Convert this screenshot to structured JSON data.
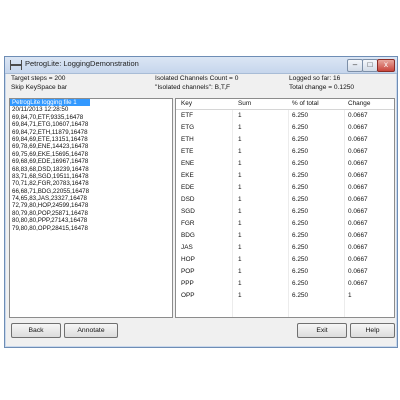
{
  "window": {
    "title": "PetrogLite: LoggingDemonstration",
    "controls": {
      "minimize": "–",
      "maximize": "□",
      "close": "x"
    }
  },
  "info": {
    "target_steps": "Target steps = 200",
    "skip_keyspace": "Skip KeySpace bar",
    "isolated_count": "Isolated Channels Count = 0",
    "isolated_channels": "\"Isolated channels\": B,T,F",
    "logged_so_far": "Logged so far: 16",
    "total_change": "Total change = 0.1250"
  },
  "log": {
    "lines": [
      "PetrogLite logging file 1",
      "20/11/2013 12:28:50",
      "69,84,70,ETF,9335,16478",
      "69,84,71,ETG,10607,16478",
      "69,84,72,ETH,11879,16478",
      "69,84,69,ETE,13151,16478",
      "69,78,69,ENE,14423,16478",
      "69,75,69,EKE,15695,16478",
      "69,68,69,EDE,16967,16478",
      "68,83,68,DSD,18239,16478",
      "83,71,68,SGD,19511,16478",
      "70,71,82,FGR,20783,16478",
      "66,68,71,BDG,22055,16478",
      "74,65,83,JAS,23327,16478",
      "72,79,80,HOP,24599,16478",
      "80,79,80,POP,25871,16478",
      "80,80,80,PPP,27143,16478",
      "79,80,80,OPP,28415,16478"
    ]
  },
  "table": {
    "headers": {
      "key": "Key",
      "sum": "Sum",
      "pct": "% of total",
      "change": "Change"
    },
    "rows": [
      {
        "key": "ETF",
        "sum": "1",
        "pct": "6.250",
        "change": "0.0667"
      },
      {
        "key": "ETG",
        "sum": "1",
        "pct": "6.250",
        "change": "0.0667"
      },
      {
        "key": "ETH",
        "sum": "1",
        "pct": "6.250",
        "change": "0.0667"
      },
      {
        "key": "ETE",
        "sum": "1",
        "pct": "6.250",
        "change": "0.0667"
      },
      {
        "key": "ENE",
        "sum": "1",
        "pct": "6.250",
        "change": "0.0667"
      },
      {
        "key": "EKE",
        "sum": "1",
        "pct": "6.250",
        "change": "0.0667"
      },
      {
        "key": "EDE",
        "sum": "1",
        "pct": "6.250",
        "change": "0.0667"
      },
      {
        "key": "DSD",
        "sum": "1",
        "pct": "6.250",
        "change": "0.0667"
      },
      {
        "key": "SGD",
        "sum": "1",
        "pct": "6.250",
        "change": "0.0667"
      },
      {
        "key": "FGR",
        "sum": "1",
        "pct": "6.250",
        "change": "0.0667"
      },
      {
        "key": "BDG",
        "sum": "1",
        "pct": "6.250",
        "change": "0.0667"
      },
      {
        "key": "JAS",
        "sum": "1",
        "pct": "6.250",
        "change": "0.0667"
      },
      {
        "key": "HOP",
        "sum": "1",
        "pct": "6.250",
        "change": "0.0667"
      },
      {
        "key": "POP",
        "sum": "1",
        "pct": "6.250",
        "change": "0.0667"
      },
      {
        "key": "PPP",
        "sum": "1",
        "pct": "6.250",
        "change": "0.0667"
      },
      {
        "key": "OPP",
        "sum": "1",
        "pct": "6.250",
        "change": "1"
      }
    ]
  },
  "buttons": {
    "back": "Back",
    "annotate": "Annotate",
    "exit": "Exit",
    "help": "Help"
  }
}
